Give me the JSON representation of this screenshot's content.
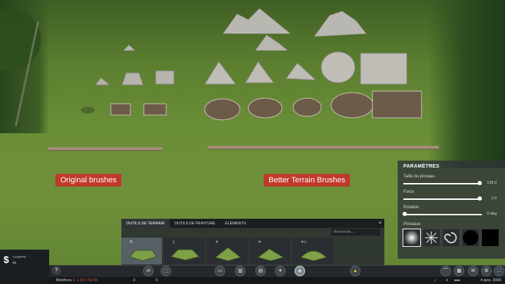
{
  "scene": {
    "label_original": "Original brushes",
    "label_better": "Better Terrain Brushes"
  },
  "params": {
    "title": "PARAMÈTRES",
    "sliders": [
      {
        "name": "Taille du pinceau",
        "value_text": "128.0",
        "level": 0.97
      },
      {
        "name": "Force",
        "value_text": "1.0",
        "level": 0.97
      },
      {
        "name": "Rotation",
        "value_text": "0 deg",
        "level": 0.02
      }
    ],
    "brushes_label": "Pinceaux",
    "brushes": [
      "soft-brush",
      "star-brush",
      "swirl-brush",
      "circle-brush",
      "square-brush"
    ]
  },
  "tools": {
    "tabs": [
      "OUTILS DE TERRAIN",
      "OUTILS DE PEINTURE",
      "ÉLÉMENTS"
    ],
    "active_tab": 0,
    "search_placeholder": "Recherche...",
    "close": "×",
    "tiles": [
      {
        "glyph": "=",
        "icon": "level-terrain-icon"
      },
      {
        "glyph": "↕",
        "icon": "shift-terrain-icon"
      },
      {
        "glyph": "+",
        "icon": "raise-terrain-icon"
      },
      {
        "glyph": "+",
        "icon": "lower-terrain-icon"
      },
      {
        "glyph": "+○",
        "icon": "soften-terrain-icon"
      }
    ]
  },
  "bottombar": {
    "money_symbol": "$",
    "account_label": "COMPTE",
    "account_value": "86",
    "help": "?",
    "benefices_label": "Bénéfices",
    "benefices_value": "$ -1 923 764 98",
    "stat_a": "0",
    "stat_b": "0",
    "date": "4 janv. 2000",
    "center_icons": [
      "shuffle-icon",
      "zoning-icon",
      "truck-icon",
      "factory-icon",
      "industry-icon",
      "plane-icon",
      "terrain-icon",
      "bulldozer-icon"
    ],
    "right_icons": [
      "chart-icon",
      "graph-icon",
      "message-icon",
      "settings-icon",
      "fullscreen-icon"
    ],
    "colors": {
      "negative": "#e04a3a",
      "accent": "#e6c400"
    }
  }
}
